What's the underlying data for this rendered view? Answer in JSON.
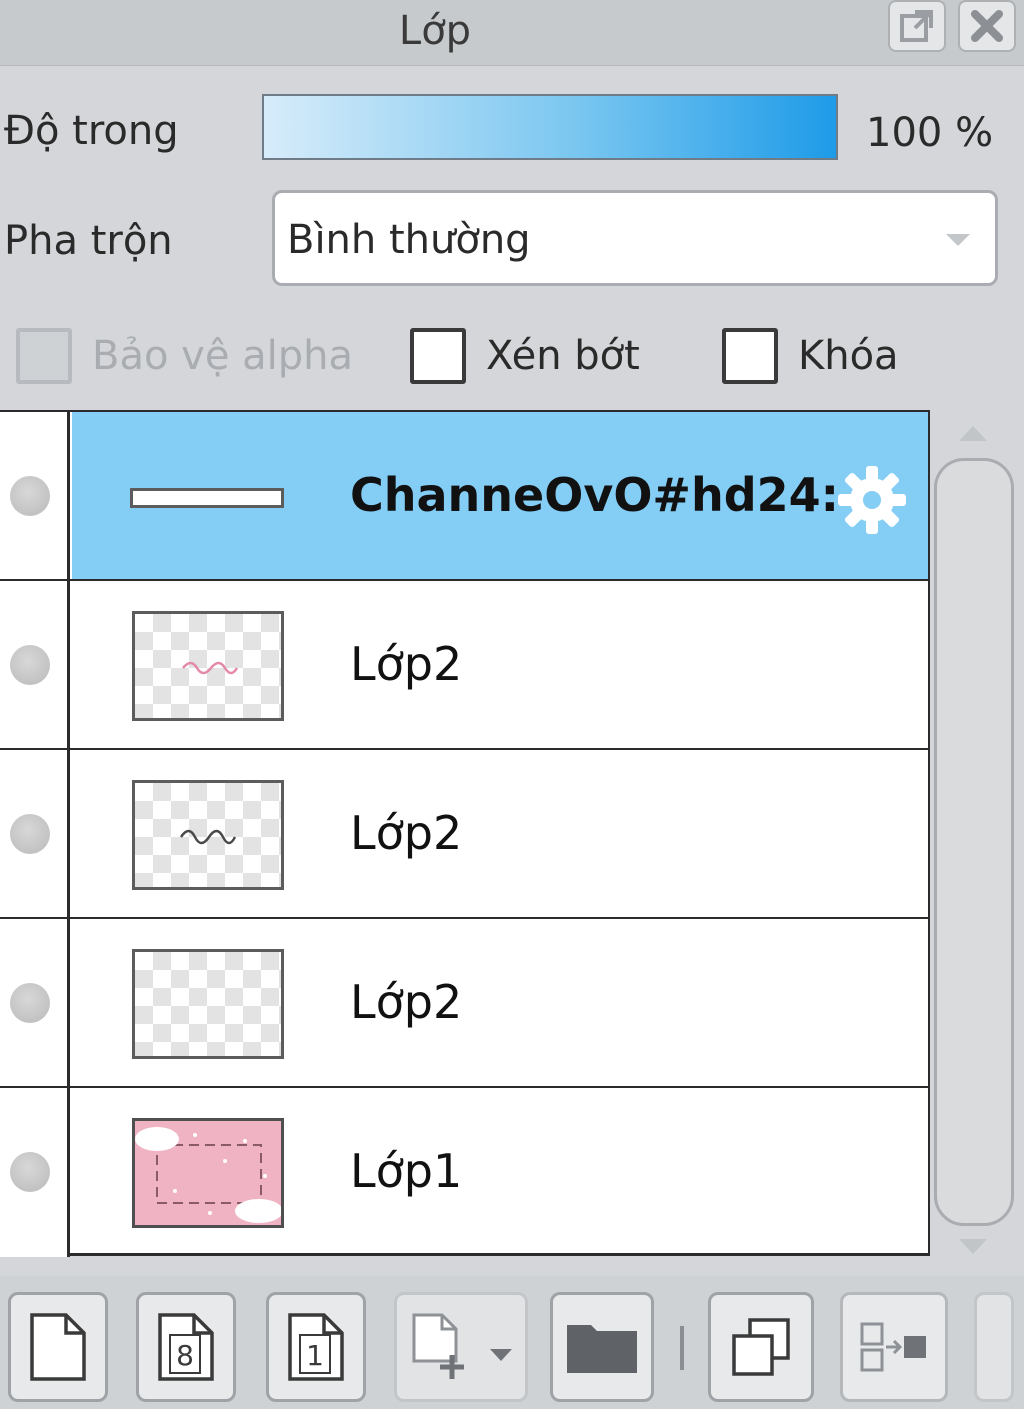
{
  "panel": {
    "title": "Lớp"
  },
  "opacity": {
    "label": "Độ trong",
    "value": "100 %",
    "fraction": 1.0
  },
  "blend": {
    "label": "Pha trộn",
    "value": "Bình thường"
  },
  "options": {
    "protect_alpha": {
      "label": "Bảo vệ alpha",
      "checked": false,
      "disabled": true
    },
    "clipping": {
      "label": "Xén bớt",
      "checked": false
    },
    "lock": {
      "label": "Khóa",
      "checked": false
    }
  },
  "layers": [
    {
      "name": "ChanneOvO#hd24:",
      "selected": true,
      "thumb": "line",
      "settings_icon": "gear-icon"
    },
    {
      "name": "Lớp2",
      "selected": false,
      "thumb": "transparent-pink-text"
    },
    {
      "name": "Lớp2",
      "selected": false,
      "thumb": "transparent-dark-text"
    },
    {
      "name": "Lớp2",
      "selected": false,
      "thumb": "transparent"
    },
    {
      "name": "Lớp1",
      "selected": false,
      "thumb": "pink-background"
    }
  ],
  "toolbar": {
    "icons": [
      "new-layer-icon",
      "new-8bit-layer-icon",
      "new-1bit-layer-icon",
      "new-layer-menu-icon",
      "new-folder-icon",
      "duplicate-layer-icon",
      "merge-layer-icon"
    ],
    "badge_8": "8",
    "badge_1": "1"
  },
  "colors": {
    "selected_row": "#84cdf5",
    "opacity_accent": "#1e9be8"
  }
}
